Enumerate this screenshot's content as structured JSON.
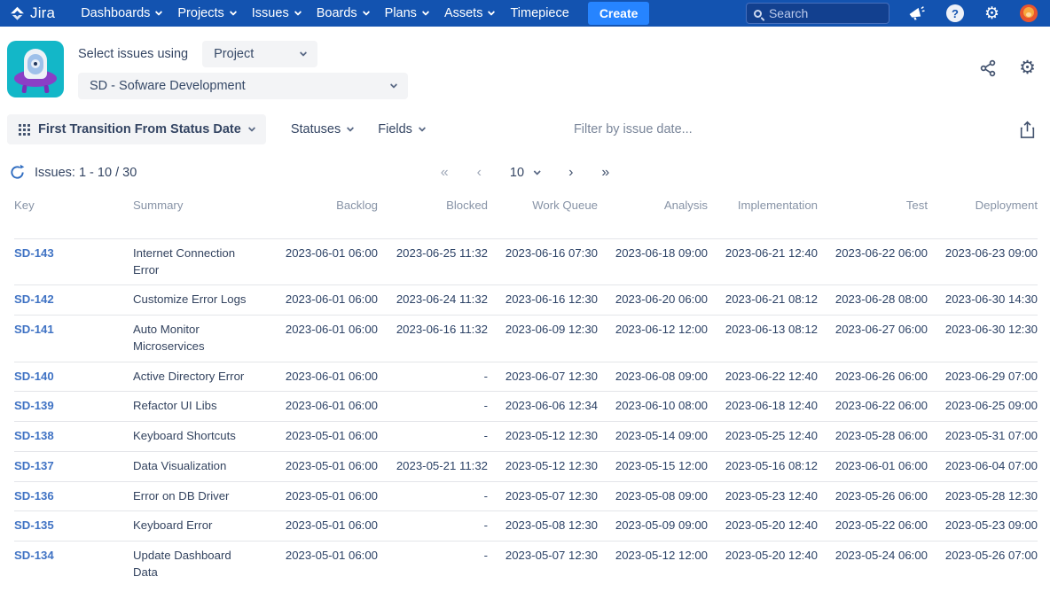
{
  "navbar": {
    "logo_text": "Jira",
    "menus": [
      {
        "label": "Dashboards",
        "chevron": true
      },
      {
        "label": "Projects",
        "chevron": true
      },
      {
        "label": "Issues",
        "chevron": true
      },
      {
        "label": "Boards",
        "chevron": true
      },
      {
        "label": "Plans",
        "chevron": true
      },
      {
        "label": "Assets",
        "chevron": true
      },
      {
        "label": "Timepiece",
        "chevron": false
      }
    ],
    "create_label": "Create",
    "search_placeholder": "Search",
    "help_glyph": "?",
    "icons": [
      "announcements-icon",
      "help-icon",
      "settings-icon",
      "user-avatar"
    ]
  },
  "icons": {
    "settings_glyph": "⚙"
  },
  "header": {
    "select_issues_label": "Select issues using",
    "mode_select_value": "Project",
    "project_select_value": "SD - Sofware Development",
    "right_icons": [
      "share-icon",
      "settings-icon"
    ]
  },
  "toolbar": {
    "report_button_label": "First Transition From Status Date",
    "statuses_label": "Statuses",
    "fields_label": "Fields",
    "date_filter_placeholder": "Filter by issue date..."
  },
  "pagination": {
    "issues_label": "Issues: 1 - 10 / 30",
    "first": "«",
    "prev": "‹",
    "page_size": "10",
    "next": "›",
    "last": "»"
  },
  "table": {
    "columns": [
      "Key",
      "Summary",
      "Backlog",
      "Blocked",
      "Work Queue",
      "Analysis",
      "Implementation",
      "Test",
      "Deployment"
    ],
    "rows": [
      {
        "key": "SD-143",
        "summary": "Internet Connection Error",
        "dates": [
          "2023-06-01 06:00",
          "2023-06-25 11:32",
          "2023-06-16 07:30",
          "2023-06-18 09:00",
          "2023-06-21 12:40",
          "2023-06-22 06:00",
          "2023-06-23 09:00"
        ]
      },
      {
        "key": "SD-142",
        "summary": "Customize Error Logs",
        "dates": [
          "2023-06-01 06:00",
          "2023-06-24 11:32",
          "2023-06-16 12:30",
          "2023-06-20 06:00",
          "2023-06-21 08:12",
          "2023-06-28 08:00",
          "2023-06-30 14:30"
        ]
      },
      {
        "key": "SD-141",
        "summary": "Auto Monitor Microservices",
        "dates": [
          "2023-06-01 06:00",
          "2023-06-16 11:32",
          "2023-06-09 12:30",
          "2023-06-12 12:00",
          "2023-06-13 08:12",
          "2023-06-27 06:00",
          "2023-06-30 12:30"
        ]
      },
      {
        "key": "SD-140",
        "summary": "Active Directory Error",
        "dates": [
          "2023-06-01 06:00",
          "-",
          "2023-06-07 12:30",
          "2023-06-08 09:00",
          "2023-06-22 12:40",
          "2023-06-26 06:00",
          "2023-06-29 07:00"
        ]
      },
      {
        "key": "SD-139",
        "summary": "Refactor UI Libs",
        "dates": [
          "2023-06-01 06:00",
          "-",
          "2023-06-06 12:34",
          "2023-06-10 08:00",
          "2023-06-18 12:40",
          "2023-06-22 06:00",
          "2023-06-25 09:00"
        ]
      },
      {
        "key": "SD-138",
        "summary": "Keyboard Shortcuts",
        "dates": [
          "2023-05-01 06:00",
          "-",
          "2023-05-12 12:30",
          "2023-05-14 09:00",
          "2023-05-25 12:40",
          "2023-05-28 06:00",
          "2023-05-31 07:00"
        ]
      },
      {
        "key": "SD-137",
        "summary": "Data Visualization",
        "dates": [
          "2023-05-01 06:00",
          "2023-05-21 11:32",
          "2023-05-12 12:30",
          "2023-05-15 12:00",
          "2023-05-16 08:12",
          "2023-06-01 06:00",
          "2023-06-04 07:00"
        ]
      },
      {
        "key": "SD-136",
        "summary": "Error on DB Driver",
        "dates": [
          "2023-05-01 06:00",
          "-",
          "2023-05-07 12:30",
          "2023-05-08 09:00",
          "2023-05-23 12:40",
          "2023-05-26 06:00",
          "2023-05-28 12:30"
        ]
      },
      {
        "key": "SD-135",
        "summary": "Keyboard Error",
        "dates": [
          "2023-05-01 06:00",
          "-",
          "2023-05-08 12:30",
          "2023-05-09 09:00",
          "2023-05-20 12:40",
          "2023-05-22 06:00",
          "2023-05-23 09:00"
        ]
      },
      {
        "key": "SD-134",
        "summary": "Update Dashboard Data",
        "dates": [
          "2023-05-01 06:00",
          "-",
          "2023-05-07 12:30",
          "2023-05-12 12:00",
          "2023-05-20 12:40",
          "2023-05-24 06:00",
          "2023-05-26 07:00"
        ]
      }
    ]
  },
  "colors": {
    "navbar_bg": "#1353b0",
    "create_button_bg": "#2684ff",
    "link_blue": "#4073c4",
    "app_icon_teal": "#13b7c8",
    "app_icon_purple": "#8a3fc6",
    "avatar_orange": "#e8542e",
    "muted_header_gray": "#8793a6"
  }
}
